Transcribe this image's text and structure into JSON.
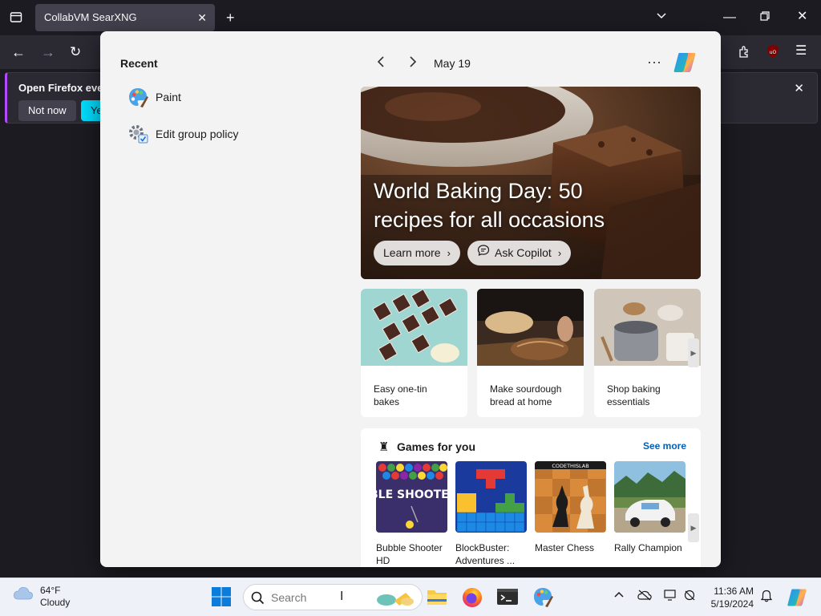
{
  "browser": {
    "tab_title": "CollabVM SearXNG",
    "notification_title": "Open Firefox ever",
    "not_now_label": "Not now",
    "yes_label_partial": "Ye"
  },
  "start_panel": {
    "recent_title": "Recent",
    "recent_items": [
      {
        "label": "Paint",
        "icon": "paint-icon"
      },
      {
        "label": "Edit group policy",
        "icon": "group-policy-icon"
      }
    ],
    "feed_date": "May 19",
    "hero": {
      "title": "World Baking Day: 50 recipes for all occasions",
      "learn_more": "Learn more",
      "ask_copilot": "Ask Copilot"
    },
    "cards": [
      {
        "caption": "Easy one-tin bakes"
      },
      {
        "caption": "Make sourdough bread at home"
      },
      {
        "caption": "Shop baking essentials"
      }
    ],
    "games": {
      "title": "Games for you",
      "see_more": "See more",
      "items": [
        {
          "name": "Bubble Shooter HD",
          "art_text": "BUBBLE SHOOTER HD"
        },
        {
          "name": "BlockBuster: Adventures ..."
        },
        {
          "name": "Master Chess",
          "art_text": "CODETHISLAB"
        },
        {
          "name": "Rally Champion"
        }
      ]
    }
  },
  "taskbar": {
    "weather_temp": "64°F",
    "weather_desc": "Cloudy",
    "search_placeholder": "Search",
    "time": "11:36 AM",
    "date": "5/19/2024"
  },
  "colors": {
    "accent_blue": "#005fb8",
    "firefox_cyan": "#00ddff",
    "panel_bg": "#f3f3f3"
  }
}
